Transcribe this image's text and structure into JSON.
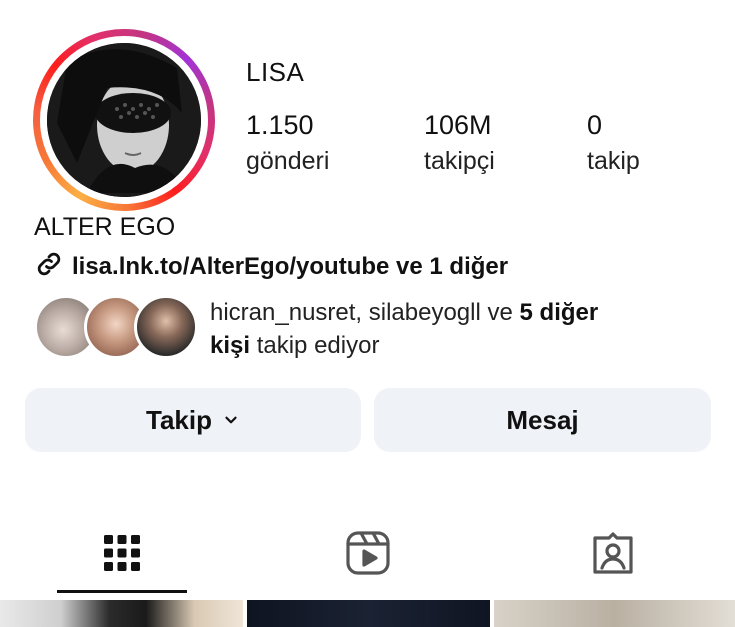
{
  "profile": {
    "username": "LISA",
    "stats": [
      {
        "value": "1.150",
        "label": "gönderi"
      },
      {
        "value": "106M",
        "label": "takipçi"
      },
      {
        "value": "0",
        "label": "takip"
      }
    ],
    "bio_name": "ALTER EGO",
    "link_text": "lisa.lnk.to/AlterEgo/youtube ve 1 diğer"
  },
  "followed_by": {
    "names": "hicran_nusret, silabeyogll",
    "connector": " ve ",
    "others_bold_1": "5 diğer",
    "others_bold_2": "kişi",
    "suffix": " takip ediyor"
  },
  "actions": {
    "follow_label": "Takip",
    "message_label": "Mesaj"
  },
  "tabs": [
    {
      "icon": "grid-icon",
      "active": true
    },
    {
      "icon": "reels-icon",
      "active": false
    },
    {
      "icon": "tagged-icon",
      "active": false
    }
  ],
  "colors": {
    "button_bg": "#eff2f6",
    "ring_orange": "#fcaf45",
    "ring_pink": "#e1306c",
    "ring_purple": "#a233d6"
  }
}
